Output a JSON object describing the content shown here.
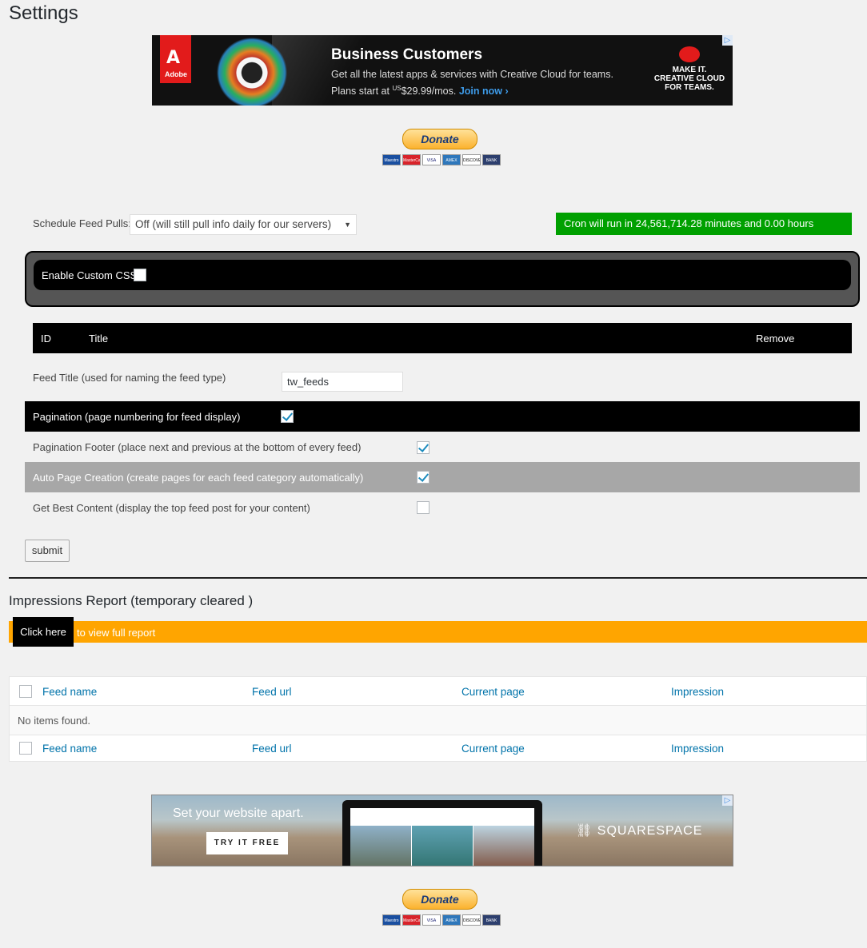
{
  "page": {
    "title": "Settings"
  },
  "ad_top": {
    "brand": "Adobe",
    "headline": "Business Customers",
    "body_line1": "Get all the latest apps & services with Creative Cloud for teams.",
    "body_line2_prefix": "Plans start at ",
    "price_currency": "US",
    "price": "$29.99/mos.",
    "cta": "Join now ›",
    "right_line1": "MAKE IT.",
    "right_line2": "CREATIVE CLOUD",
    "right_line3": "FOR TEAMS.",
    "adchoices": "▷"
  },
  "donate": {
    "label": "Donate",
    "cards": [
      "Maestro",
      "MasterCard",
      "VISA",
      "AMEX",
      "DISCOVER",
      "BANK"
    ]
  },
  "schedule": {
    "label": "Schedule Feed Pulls:",
    "selected": "Off (will still pull info daily for our servers)",
    "cron_status": "Cron will run in 24,561,714.28 minutes and 0.00 hours"
  },
  "custom_css": {
    "label": "Enable Custom CSS",
    "checked": false
  },
  "feeds_header": {
    "id": "ID",
    "title": "Title",
    "remove": "Remove"
  },
  "feed_title": {
    "label": "Feed Title (used for naming the feed type)",
    "value": "tw_feeds"
  },
  "options": [
    {
      "label": "Pagination (page numbering for feed display)",
      "checked": true
    },
    {
      "label": "Pagination Footer (place next and previous at the bottom of every feed)",
      "checked": true
    },
    {
      "label": "Auto Page Creation (create pages for each feed category automatically)",
      "checked": true
    },
    {
      "label": "Get Best Content (display the top feed post for your content)",
      "checked": false
    }
  ],
  "submit_label": "submit",
  "impressions": {
    "title": "Impressions Report (temporary cleared )",
    "click_here": "Click here",
    "click_suffix": "to view full report",
    "columns": [
      "Feed name",
      "Feed url",
      "Current page",
      "Impression"
    ],
    "empty_text": "No items found."
  },
  "ad_bottom": {
    "headline": "Set your website apart.",
    "cta": "TRY IT FREE",
    "brand": "SQUARESPACE",
    "adchoices": "▷"
  },
  "colors": {
    "cron_bg": "#00a000",
    "orange_bar": "#ffa500",
    "link": "#0073aa",
    "background": "#f1f1f1"
  }
}
